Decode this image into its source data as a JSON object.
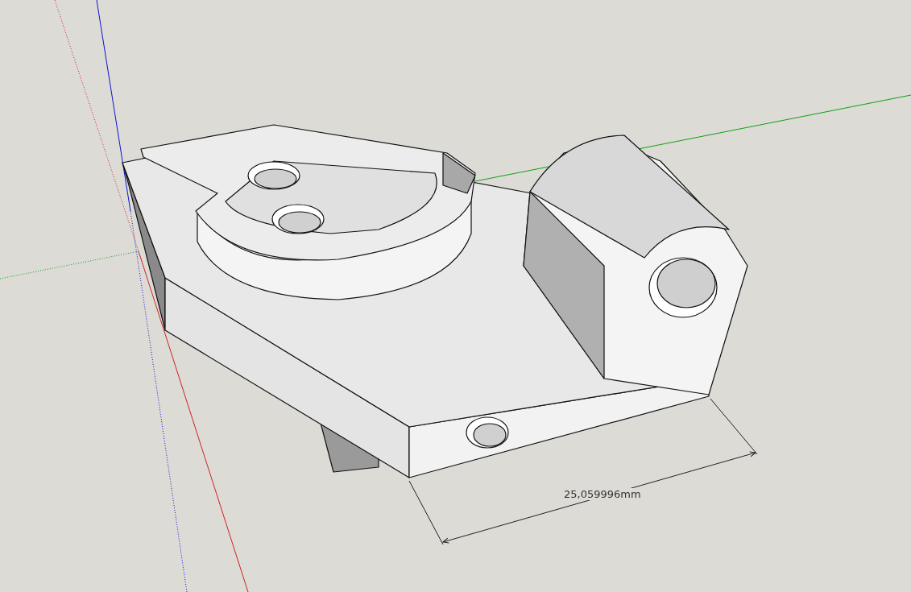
{
  "viewport": {
    "dimension": {
      "label": "25,059996mm"
    }
  }
}
